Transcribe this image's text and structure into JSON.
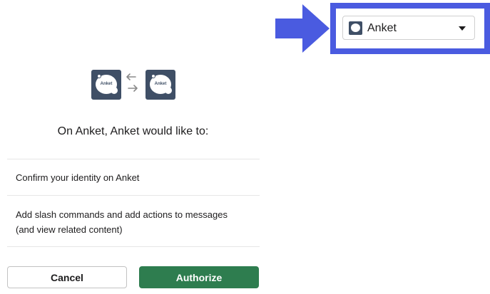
{
  "auth": {
    "app_logo_text": "Anket",
    "workspace_logo_text": "Anket",
    "heading": "On Anket, Anket would like to:",
    "permissions": [
      "Confirm your identity on Anket",
      "Add slash commands and add actions to messages",
      "(and view related content)"
    ],
    "cancel_label": "Cancel",
    "authorize_label": "Authorize"
  },
  "workspace_switcher": {
    "selected": "Anket",
    "icon": "workspace-logo-icon"
  },
  "annotation": {
    "color": "#4a5be0",
    "icon": "right-arrow-icon"
  },
  "colors": {
    "authorize_button": "#2e7d4f",
    "logo_background": "#3f4f66"
  }
}
